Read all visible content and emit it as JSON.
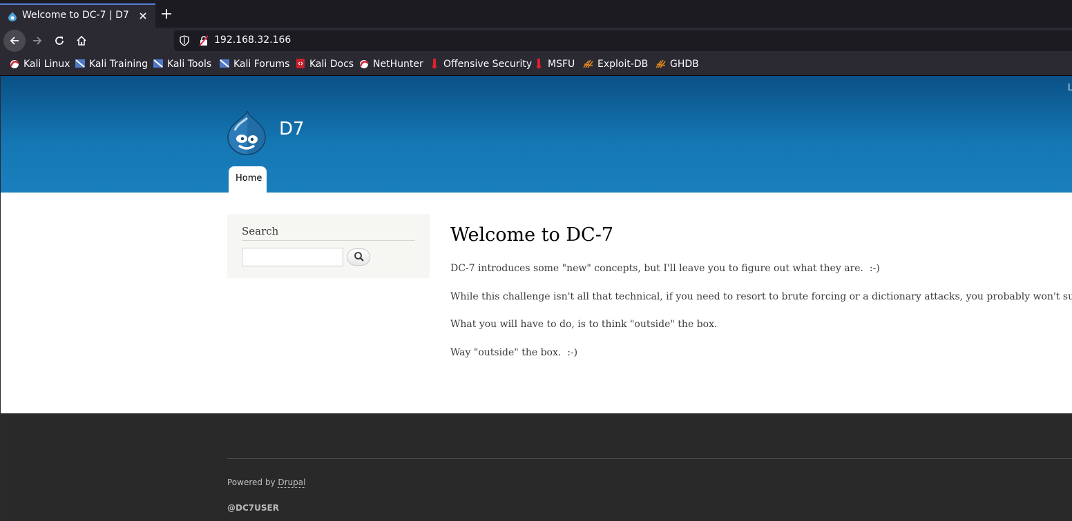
{
  "browser": {
    "tab_title": "Welcome to DC-7 | D7",
    "url": "192.168.32.166",
    "bookmarks": [
      {
        "label": "Kali Linux",
        "icon": "kali-icon"
      },
      {
        "label": "Kali Training",
        "icon": "kali-training-icon"
      },
      {
        "label": "Kali Tools",
        "icon": "kali-tools-icon"
      },
      {
        "label": "Kali Forums",
        "icon": "kali-forums-icon"
      },
      {
        "label": "Kali Docs",
        "icon": "kali-docs-icon"
      },
      {
        "label": "NetHunter",
        "icon": "nethunter-icon"
      },
      {
        "label": "Offensive Security",
        "icon": "offsec-icon"
      },
      {
        "label": "MSFU",
        "icon": "msfu-icon"
      },
      {
        "label": "Exploit-DB",
        "icon": "exploitdb-icon"
      },
      {
        "label": "GHDB",
        "icon": "ghdb-icon"
      }
    ],
    "colors": {
      "chrome_dark": "#1c1b22",
      "chrome": "#2b2a33",
      "accent": "#5b7fd8"
    }
  },
  "site": {
    "name": "D7",
    "corner_text": "L",
    "nav": {
      "home": "Home"
    },
    "colors": {
      "header_top": "#0a5186",
      "header_bottom": "#1a7fbd",
      "footer": "#292929"
    }
  },
  "sidebar": {
    "title": "Search",
    "search_placeholder": ""
  },
  "main": {
    "heading": "Welcome to DC-7",
    "paragraphs": [
      "DC-7 introduces some \"new\" concepts, but I'll leave you to figure out what they are.  :-)",
      "While this challenge isn't all that technical, if you need to resort to brute forcing or a dictionary attacks, you probably won't succeed.",
      "What you will have to do, is to think \"outside\" the box.",
      "Way \"outside\" the box.  :-)"
    ]
  },
  "footer": {
    "powered_prefix": "Powered by ",
    "powered_link": "Drupal",
    "user": "@DC7USER"
  }
}
